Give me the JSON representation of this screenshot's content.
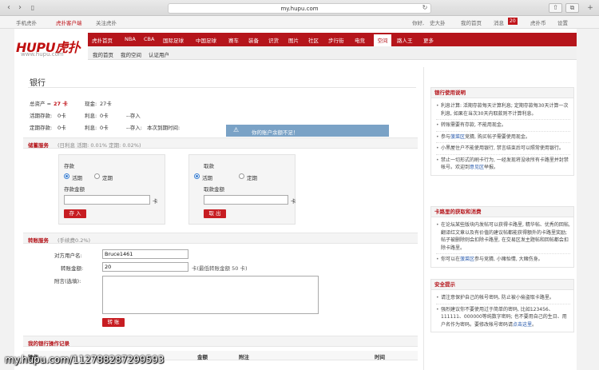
{
  "browser": {
    "url": "my.hupu.com"
  },
  "topbar": {
    "left": [
      "手机虎扑",
      "虎扑客户端",
      "关注虎扑"
    ],
    "greeting": "你好,",
    "username": "史大卦",
    "links": [
      "我的首页",
      "消息",
      "虎扑币",
      "设置"
    ],
    "msg_count": "20"
  },
  "logo": {
    "text": "HUPU虎扑",
    "url": "www.hupu.com"
  },
  "mainnav": {
    "items": [
      "虎扑首页",
      "NBA",
      "CBA",
      "国际足球",
      "中国足球",
      "赛车",
      "装备",
      "识货",
      "图片",
      "社区",
      "步行街",
      "电竞",
      "空间",
      "路人王",
      "更多"
    ],
    "active": "空间"
  },
  "subnav": {
    "items": [
      "我的首页",
      "我的空间",
      "认证用户"
    ]
  },
  "bank": {
    "title": "银行",
    "total_label": "总资产 =",
    "total_value": "27 卡",
    "cash_label": "现金:",
    "cash_value": "27卡",
    "current_label": "活期存款:",
    "current_value": "0卡",
    "current_interest_label": "利息:",
    "current_interest_value": "0卡",
    "current_note": "--存入",
    "fixed_label": "定期存款:",
    "fixed_value": "0卡",
    "fixed_interest_label": "利息:",
    "fixed_interest_value": "0卡",
    "fixed_note": "--存入:",
    "fixed_note2": "本次到期时间:"
  },
  "toast": {
    "text": "你的账户余额不足！"
  },
  "deposit_section": {
    "title": "储蓄服务",
    "rates": "(日利息 活期: 0.01%   定期: 0.02%)"
  },
  "deposit": {
    "title": "存款",
    "opt_current": "活期",
    "opt_fixed": "定期",
    "amount_label": "存款金额",
    "unit": "卡",
    "button": "存 入"
  },
  "withdraw": {
    "title": "取款",
    "opt_current": "活期",
    "opt_fixed": "定期",
    "amount_label": "取款金额",
    "unit": "卡",
    "button": "取 出"
  },
  "transfer_section": {
    "title": "转账服务",
    "fee": "(手续费0.2%)"
  },
  "transfer": {
    "to_label": "对方用户名:",
    "to_value": "Bruce1461",
    "amount_label": "转账金额:",
    "amount_value": "20",
    "amount_hint": "卡(最低转账金额 50 卡)",
    "note_label": "附言(选填):",
    "button": "转 账"
  },
  "records": {
    "title": "我的银行操作记录",
    "columns": [
      "操作",
      "金额",
      "附注",
      "时间"
    ]
  },
  "sidebar": {
    "usage": {
      "title": "银行使用说明",
      "items": [
        "利息计算: 活期存款每天计算利息; 定期存款每30天计算一次利息, 如果在当次30天内取款则不计算利息。",
        "转账需要有存款, 不能用现金。",
        "参与{link}竞猜, 购买帖子需要使用现金。",
        "小黑屋住户不能使用银行, 禁言结束后可以照常使用银行。",
        "禁止一切形式的刷卡行为, 一经发现将没收所有卡路里并封禁帐号。欢迎到{link2}举报。"
      ],
      "link": "菠菜区",
      "link2": "意见区"
    },
    "earn": {
      "title": "卡路里的获取和消费",
      "items": [
        "在论坛某些版块内发帖可以获得卡路里, 精华帖、优秀的回帖, 翻译红文章以及有价值的建议帖都能获得额外的卡路里奖励; 帖子被删除则会扣除卡路里, 在交易区发主题帖和回帖都会扣除卡路里。",
        "你可以在{link}参与竞猜, 小赌怡情, 大赌伤身。"
      ],
      "link": "菠菜区"
    },
    "safety": {
      "title": "安全提示",
      "items": [
        "请注意保护自己的帐号密码, 防止被小偷盗取卡路里。",
        "强烈建议你不要使用过于简单的密码, 比如123456、111111、000000等纯数字密码; 也不要用自己的生日、用户名作为密码。要修改帐号密码请{link}。"
      ],
      "link": "点击这里"
    }
  },
  "watermark": "my.hupu.com/112788287299593"
}
